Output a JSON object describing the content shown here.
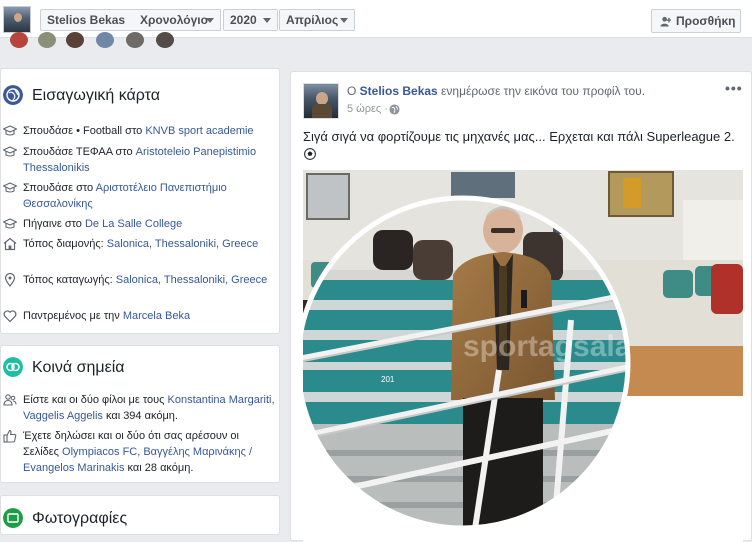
{
  "topbar": {
    "name": "Stelios Bekas",
    "timeline": "Χρονολόγιο",
    "year": "2020",
    "month": "Απρίλιος",
    "add_friend": "Προσθήκη"
  },
  "intro": {
    "title": "Εισαγωγική κάρτα",
    "items": [
      {
        "icon": "graduation-cap-icon",
        "prefix": "Σπουδάσε • Football στο ",
        "link": "KNVB sport academie",
        "suffix": ""
      },
      {
        "icon": "graduation-cap-icon",
        "prefix": "Σπουδάσε ΤΕΦΑΑ στο ",
        "link": "Aristoteleio Panepistimio Thessalonikis",
        "suffix": ""
      },
      {
        "icon": "graduation-cap-icon",
        "prefix": "Σπουδάσε στο ",
        "link": "Αριστοτέλειο Πανεπιστήμιο Θεσσαλονίκης",
        "suffix": ""
      },
      {
        "icon": "graduation-cap-icon",
        "prefix": "Πήγαινε στο ",
        "link": "De La Salle College",
        "suffix": ""
      },
      {
        "icon": "home-icon",
        "prefix": "Τόπος διαμονής: ",
        "link": "Salonica, Thessaloniki, Greece",
        "suffix": ""
      },
      {
        "icon": "location-pin-icon",
        "prefix": "Τόπος καταγωγής: ",
        "link": "Salonica, Thessaloniki, Greece",
        "suffix": ""
      },
      {
        "icon": "heart-icon",
        "prefix": "Παντρεμένος με την ",
        "link": "Marcela Beka",
        "suffix": ""
      }
    ]
  },
  "common": {
    "title": "Κοινά σημεία",
    "items": [
      {
        "icon": "friends-icon",
        "prefix": "Είστε και οι δύο φίλοι με τους ",
        "link": "Konstantina Margariti, Vaggelis Aggelis",
        "suffix": " και 394 ακόμη."
      },
      {
        "icon": "like-icon",
        "prefix": "Έχετε δηλώσει και οι δύο ότι σας αρέσουν οι Σελίδες ",
        "link": "Olympiacos FC, Βαγγέλης Μαρινάκης / Evangelos Marinakis",
        "suffix": " και 28 ακόμη."
      }
    ]
  },
  "photos": {
    "title": "Φωτογραφίες"
  },
  "post": {
    "prefix": "Ο ",
    "author": "Stelios Bekas",
    "action": " ενημέρωσε την εικόνα του προφίλ του.",
    "time": "5 ώρες · ",
    "more": "•••",
    "text": "Σιγά σιγά να φορτίζουμε τις μηχανές μας... Ερχεται και πάλι Superleague 2.",
    "watermark": "sportagsalan.gr",
    "seat_number": "201"
  },
  "colors": {
    "accent": "#4267b2",
    "link": "#365899",
    "intro_icon": "#3b5998",
    "common_icon": "#1ebea5",
    "photos_icon": "#1d9b46"
  }
}
